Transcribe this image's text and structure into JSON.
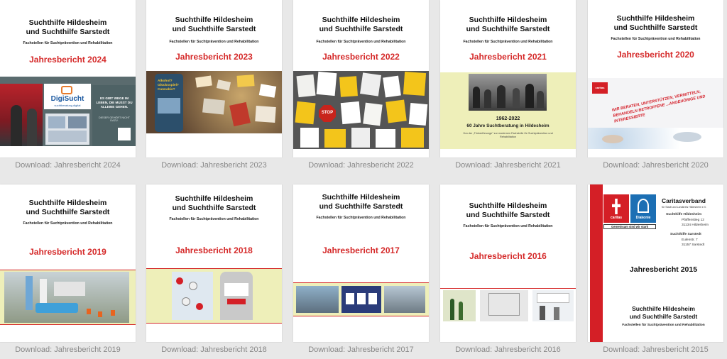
{
  "common": {
    "org_line1": "Suchthilfe Hildesheim",
    "org_line2": "und Suchthilfe Sarstedt",
    "subtitle": "Fachstellen für Suchtprävention und Rehabilitation"
  },
  "covers": [
    {
      "year_title": "Jahresbericht 2024",
      "download": "Download: Jahresbericht 2024",
      "logo_text": "DigiSucht",
      "logo_sub": "suchtberatung.digital",
      "promo_text": "ES GIBT WEGE IM LEBEN, DIE MUSST DU ALLEINE GEHEN.",
      "promo_sub": "DIESER GEHÖRT NICHT DAZU."
    },
    {
      "year_title": "Jahresbericht 2023",
      "download": "Download: Jahresbericht 2023",
      "phone_text": "Alkohol? Glücksspiel? Cannabis?"
    },
    {
      "year_title": "Jahresbericht 2022",
      "download": "Download: Jahresbericht 2022",
      "stop_text": "STOP"
    },
    {
      "year_title": "Jahresbericht 2021",
      "download": "Download: Jahresbericht 2021",
      "years_range": "1962-2022",
      "anniversary": "60 Jahre Suchtberatung in Hildesheim",
      "anniversary_sub": "Von der „Trinkerfürsorge\" zur modernen Fachstelle für Suchtprävention und Rehabilitation"
    },
    {
      "year_title": "Jahresbericht 2020",
      "download": "Download: Jahresbericht 2020",
      "slogan": "WIR BERATEN, UNTERSTÜTZEN, VERMITTELN, BEHANDELN BETROFFENE ...ANGEHÖRIGE UND INTERESSIERTE",
      "caritas_logo": "caritas"
    },
    {
      "year_title": "Jahresbericht 2019",
      "download": "Download: Jahresbericht 2019"
    },
    {
      "year_title": "Jahresbericht 2018",
      "download": "Download: Jahresbericht 2018"
    },
    {
      "year_title": "Jahresbericht 2017",
      "download": "Download: Jahresbericht 2017"
    },
    {
      "year_title": "Jahresbericht 2016",
      "download": "Download: Jahresbericht 2016"
    },
    {
      "year_title": "Jahresbericht 2015",
      "download": "Download: Jahresbericht 2015",
      "caritas": "caritas",
      "diakonie": "Diakonie",
      "tagline": "Gemeinsam sind wir stark",
      "verband": "Caritasverband",
      "verband_sub": "für Stadt und Landkreis Hildesheim e.V.",
      "addr1_name": "Suchthilfe Hildesheim",
      "addr1_street": "Pfaffenstieg 12",
      "addr1_city": "31134 Hildesheim",
      "addr2_name": "Suchthilfe Sarstedt",
      "addr2_street": "Eulenstr. 7",
      "addr2_city": "31157 Sarstedt"
    }
  ],
  "colors": {
    "accent_red": "#d52a2a",
    "page_bg": "#e8e8e8",
    "caritas_red": "#d41f26",
    "diakonie_blue": "#1c6fb4"
  }
}
